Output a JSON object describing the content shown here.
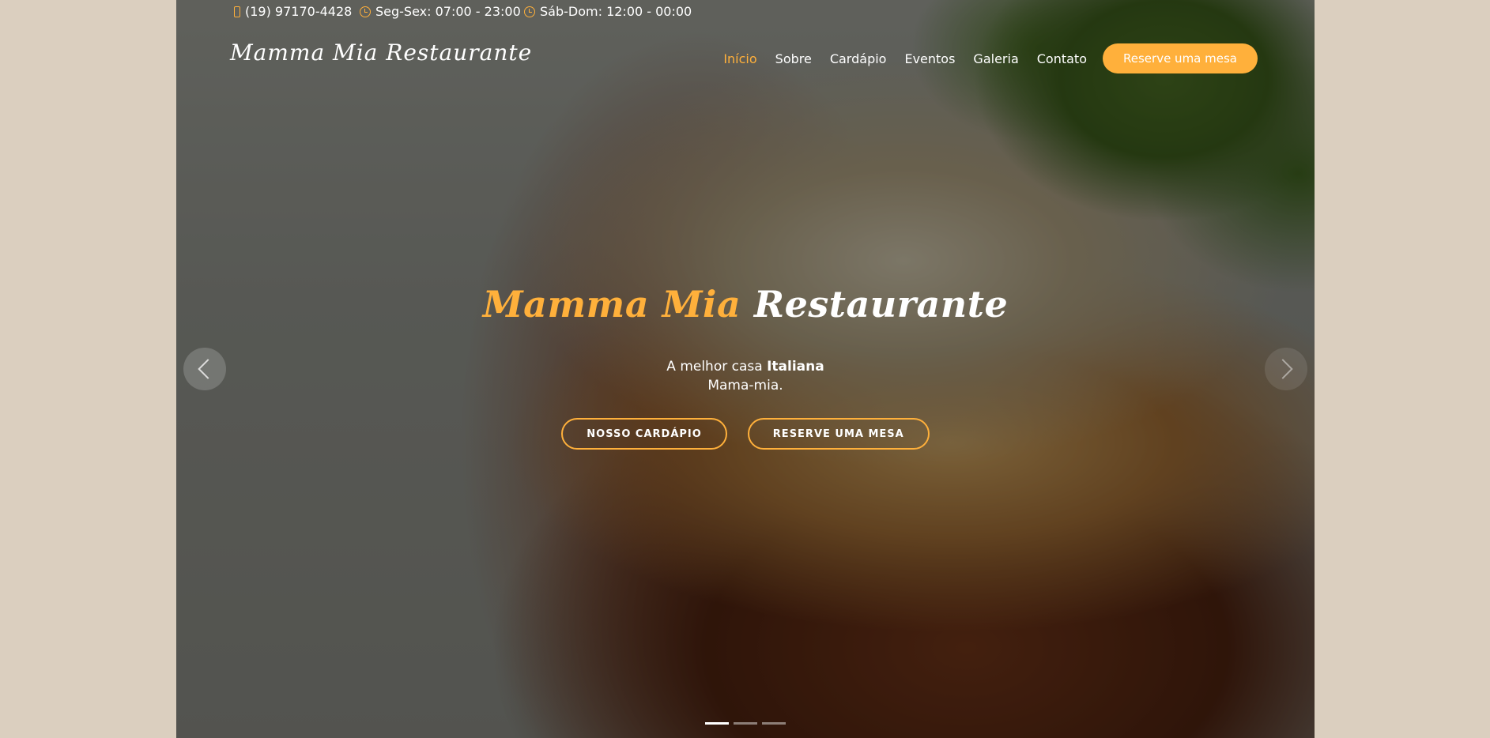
{
  "topbar": {
    "phone": "(19) 97170-4428",
    "hours_weekdays": "Seg-Sex: 07:00 - 23:00",
    "hours_weekend": "Sáb-Dom: 12:00 - 00:00"
  },
  "header": {
    "logo": "Mamma Mia Restaurante",
    "nav": {
      "inicio": "Início",
      "sobre": "Sobre",
      "cardapio": "Cardápio",
      "eventos": "Eventos",
      "galeria": "Galeria",
      "contato": "Contato"
    },
    "book_button": "Reserve uma mesa"
  },
  "hero": {
    "title_accent": "Mamma Mia",
    "title_rest": "Restaurante",
    "subtitle_prefix": "A melhor casa",
    "subtitle_bold": "Italiana",
    "subtitle_line2": "Mama-mia.",
    "button_menu": "NOSSO CARDÁPIO",
    "button_book": "RESERVE UMA MESA"
  },
  "carousel": {
    "active_slide": 1,
    "slides_total": 3
  },
  "colors": {
    "accent": "#ffb03b",
    "page_background": "#dbcfbf"
  }
}
